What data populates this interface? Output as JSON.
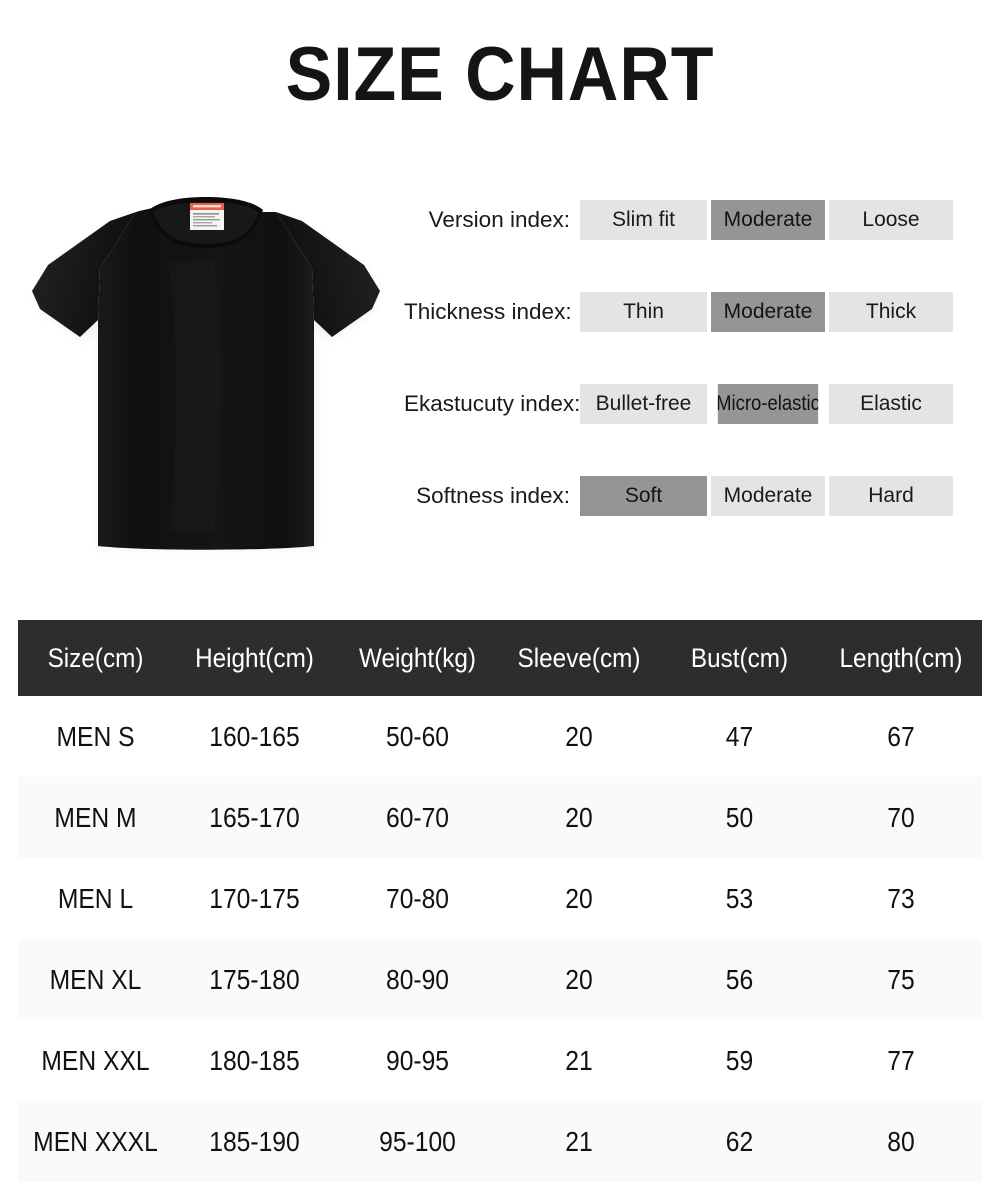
{
  "title": "SIZE CHART",
  "product": {
    "alt_name": "black-crew-neck-t-shirt",
    "body_color": "#121212",
    "shade_color": "#1e1e1e",
    "label_color": "#f2f2f2",
    "label_accent": "#e8604c"
  },
  "indices": [
    {
      "label": "Version index:",
      "options": [
        {
          "text": "Slim fit",
          "selected": false
        },
        {
          "text": "Moderate",
          "selected": true
        },
        {
          "text": "Loose",
          "selected": false
        }
      ]
    },
    {
      "label": "Thickness index:",
      "options": [
        {
          "text": "Thin",
          "selected": false
        },
        {
          "text": "Moderate",
          "selected": true
        },
        {
          "text": "Thick",
          "selected": false
        }
      ]
    },
    {
      "label": "Ekastucuty index:",
      "options": [
        {
          "text": "Bullet-free",
          "selected": false
        },
        {
          "text": "Micro-elastic",
          "selected": true
        },
        {
          "text": "Elastic",
          "selected": false
        }
      ]
    },
    {
      "label": "Softness index:",
      "options": [
        {
          "text": "Soft",
          "selected": true
        },
        {
          "text": "Moderate",
          "selected": false
        },
        {
          "text": "Hard",
          "selected": false
        }
      ]
    }
  ],
  "colors": {
    "header_bg": "#2d2d2d",
    "header_text": "#ffffff",
    "option_bg": "#e4e4e4",
    "option_selected_bg": "#959595",
    "row_alt_bg": "#fafafa",
    "page_bg": "#ffffff",
    "text": "#111111"
  },
  "chart_data": {
    "type": "table",
    "title": "SIZE CHART",
    "columns": [
      "Size(cm)",
      "Height(cm)",
      "Weight(kg)",
      "Sleeve(cm)",
      "Bust(cm)",
      "Length(cm)"
    ],
    "rows": [
      [
        "MEN S",
        "160-165",
        "50-60",
        "20",
        "47",
        "67"
      ],
      [
        "MEN M",
        "165-170",
        "60-70",
        "20",
        "50",
        "70"
      ],
      [
        "MEN L",
        "170-175",
        "70-80",
        "20",
        "53",
        "73"
      ],
      [
        "MEN XL",
        "175-180",
        "80-90",
        "20",
        "56",
        "75"
      ],
      [
        "MEN XXL",
        "180-185",
        "90-95",
        "21",
        "59",
        "77"
      ],
      [
        "MEN XXXL",
        "185-190",
        "95-100",
        "21",
        "62",
        "80"
      ]
    ]
  }
}
